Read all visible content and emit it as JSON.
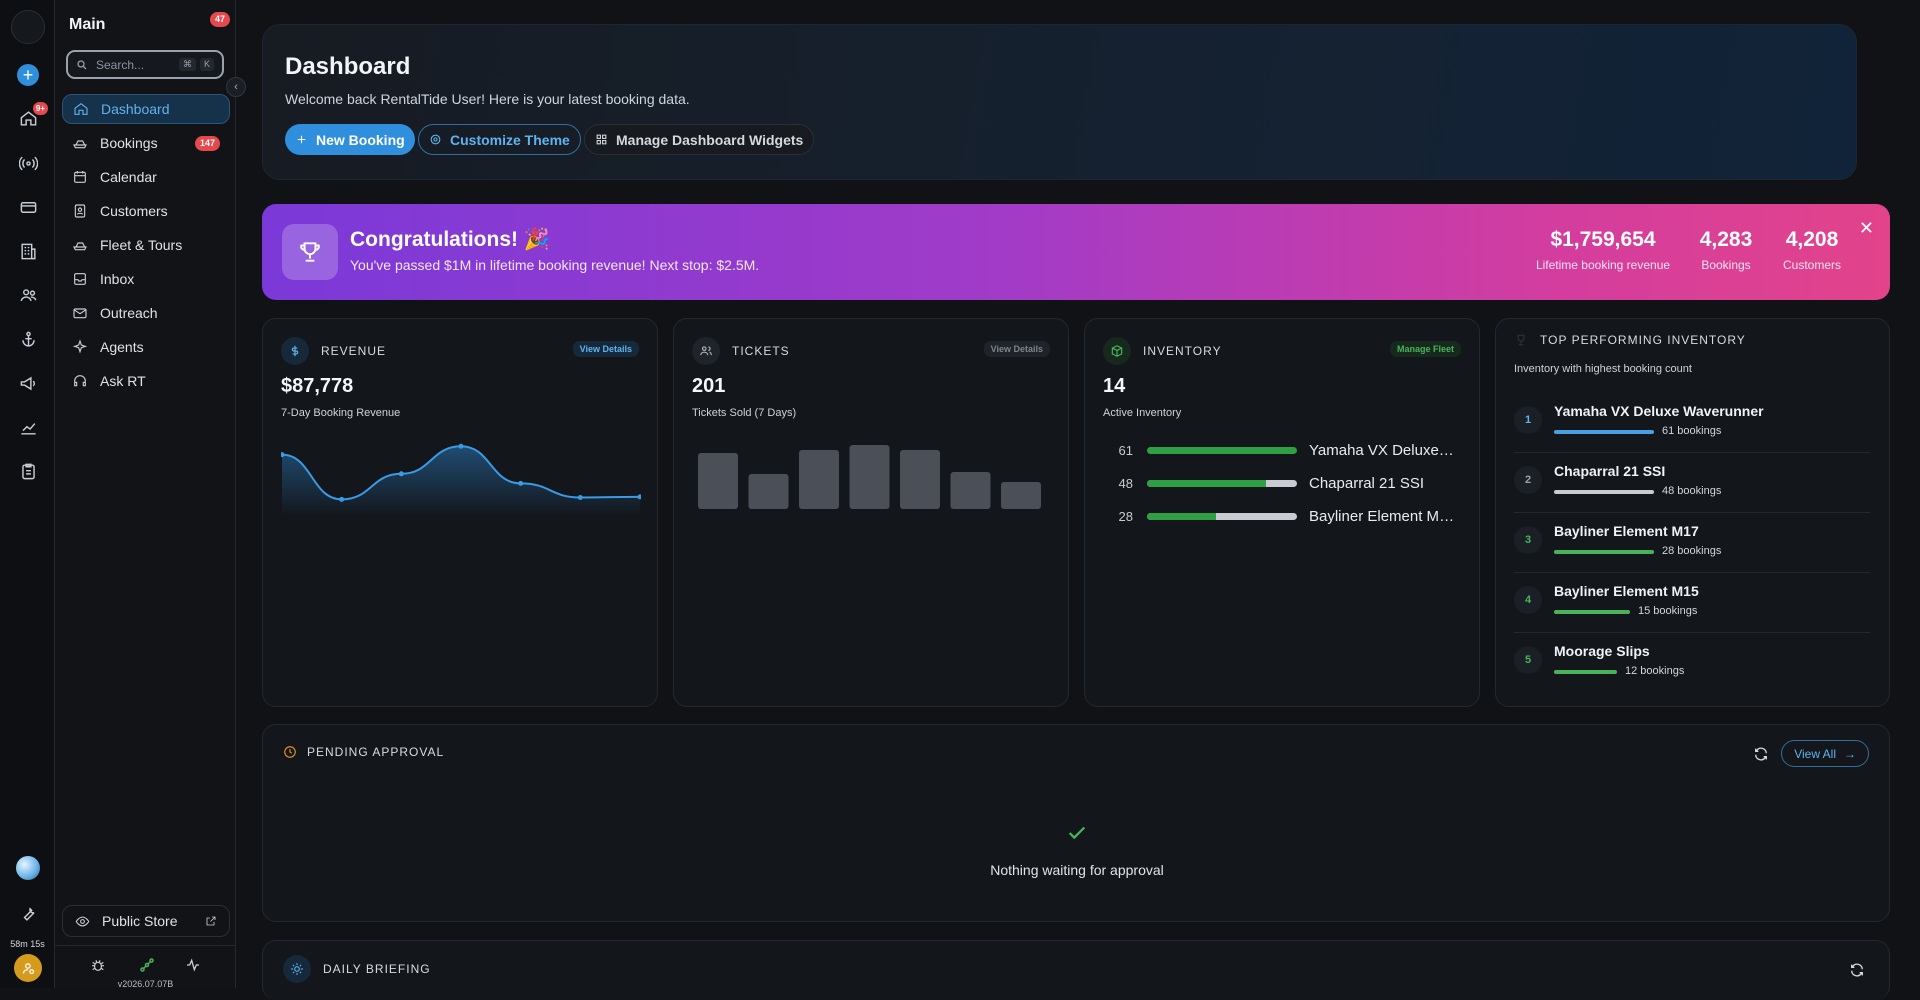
{
  "sidebar": {
    "title": "Main",
    "title_badge": "47",
    "search": {
      "placeholder": "Search...",
      "kbd_1": "⌘",
      "kbd_2": "K"
    },
    "items": [
      {
        "label": "Dashboard",
        "badge": ""
      },
      {
        "label": "Bookings",
        "badge": "147"
      },
      {
        "label": "Calendar",
        "badge": ""
      },
      {
        "label": "Customers",
        "badge": ""
      },
      {
        "label": "Fleet & Tours",
        "badge": ""
      },
      {
        "label": "Inbox",
        "badge": ""
      },
      {
        "label": "Outreach",
        "badge": ""
      },
      {
        "label": "Agents",
        "badge": ""
      },
      {
        "label": "Ask RT",
        "badge": ""
      }
    ],
    "public_store": "Public Store",
    "version": "v2026.07.07B"
  },
  "rail": {
    "home_badge": "9+",
    "timer": "58m 15s"
  },
  "hero": {
    "title": "Dashboard",
    "subtitle": "Welcome back RentalTide User! Here is your latest booking data.",
    "new_booking": "New Booking",
    "customize_theme": "Customize Theme",
    "manage_widgets": "Manage Dashboard Widgets"
  },
  "congrats": {
    "title": "Congratulations! 🎉",
    "message": "You've passed $1M in lifetime booking revenue! Next stop: $2.5M.",
    "stats": [
      {
        "value": "$1,759,654",
        "label": "Lifetime booking revenue"
      },
      {
        "value": "4,283",
        "label": "Bookings"
      },
      {
        "value": "4,208",
        "label": "Customers"
      }
    ]
  },
  "revenue": {
    "header": "REVENUE",
    "action": "View Details",
    "value": "$87,778",
    "caption": "7-Day Booking Revenue",
    "points": [
      0.15,
      0.85,
      0.45,
      0.02,
      0.6,
      0.82,
      0.81
    ]
  },
  "tickets": {
    "header": "TICKETS",
    "action": "View Details",
    "value": "201",
    "caption": "Tickets Sold (7 Days)",
    "bars": [
      0.88,
      0.55,
      0.92,
      1.0,
      0.92,
      0.58,
      0.42
    ]
  },
  "inventory": {
    "header": "INVENTORY",
    "action": "Manage Fleet",
    "value": "14",
    "caption": "Active Inventory",
    "rows": [
      {
        "count": "61",
        "name": "Yamaha VX Deluxe Waverunner",
        "fill": 1.0
      },
      {
        "count": "48",
        "name": "Chaparral 21 SSI",
        "fill": 0.79
      },
      {
        "count": "28",
        "name": "Bayliner Element M17",
        "fill": 0.46
      }
    ]
  },
  "top": {
    "header": "TOP PERFORMING INVENTORY",
    "sub": "Inventory with highest booking count",
    "items": [
      {
        "rank": "1",
        "name": "Yamaha VX Deluxe Waverunner",
        "count": "61 bookings",
        "fill": 1.0,
        "color": "#4a9fe0",
        "rank_color": "#5fb3ee"
      },
      {
        "rank": "2",
        "name": "Chaparral 21 SSI",
        "count": "48 bookings",
        "fill": 1.0,
        "color": "#c8ccd2",
        "rank_color": "#9aa1ab"
      },
      {
        "rank": "3",
        "name": "Bayliner Element M17",
        "count": "28 bookings",
        "fill": 1.0,
        "color": "#49b35a",
        "rank_color": "#49b35a"
      },
      {
        "rank": "4",
        "name": "Bayliner Element M15",
        "count": "15 bookings",
        "fill": 0.76,
        "color": "#49b35a",
        "rank_color": "#49b35a"
      },
      {
        "rank": "5",
        "name": "Moorage Slips",
        "count": "12 bookings",
        "fill": 0.63,
        "color": "#49b35a",
        "rank_color": "#49b35a"
      }
    ]
  },
  "pending": {
    "header": "PENDING APPROVAL",
    "view_all": "View All",
    "empty": "Nothing waiting for approval"
  },
  "briefing": {
    "header": "DAILY BRIEFING"
  }
}
